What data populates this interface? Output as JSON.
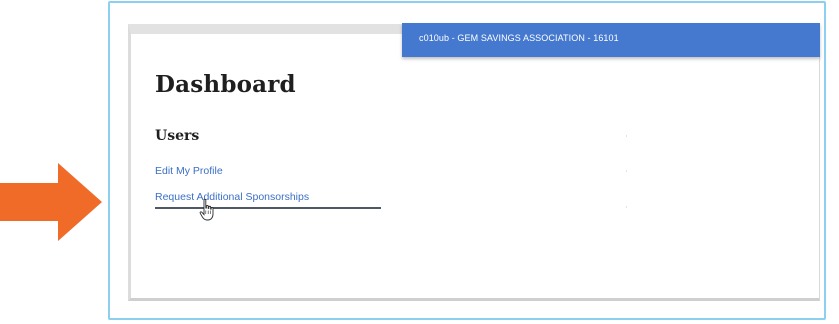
{
  "header": {
    "account_text": "c010ub - GEM SAVINGS ASSOCIATION - 16101"
  },
  "page": {
    "title": "Dashboard"
  },
  "users_section": {
    "title": "Users",
    "links": [
      {
        "label": "Edit My Profile"
      },
      {
        "label": "Request Additional Sponsorships"
      }
    ]
  },
  "colors": {
    "arrow": "#f06b28",
    "frame": "#8ccff0",
    "header_bar": "#4479cf",
    "link": "#3b6fc6"
  },
  "icons": {
    "callout_arrow": "arrow-right-icon",
    "pointer": "hand-pointer-icon"
  }
}
